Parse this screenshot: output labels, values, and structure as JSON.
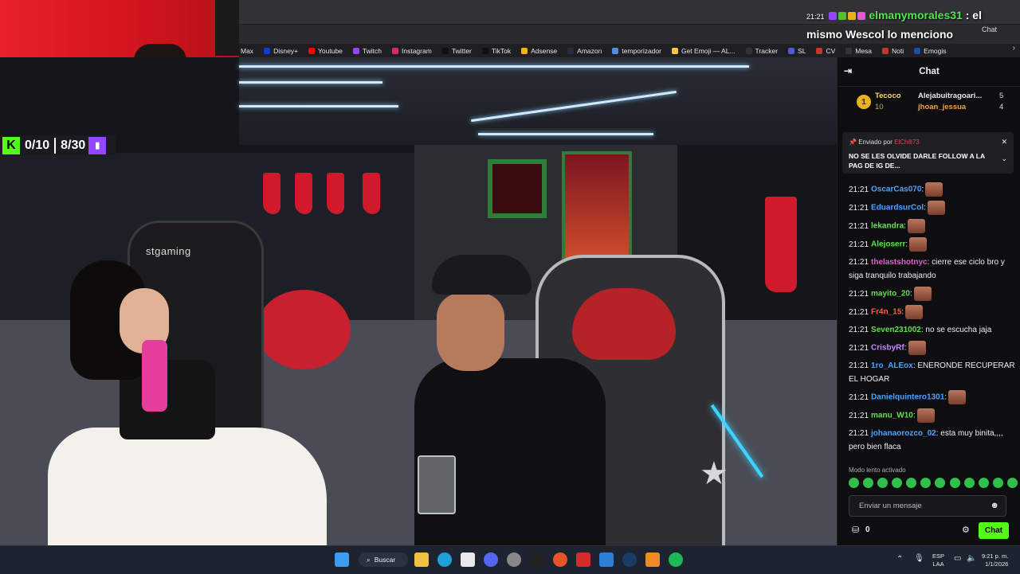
{
  "overlay": {
    "time": "21:21",
    "username": "elmanymorales31",
    "message_a": ": el",
    "message_b": "mismo Wescol lo menciono",
    "chat_label": "Chat"
  },
  "bookmarks": [
    {
      "label": "Max",
      "color": "#2a50d6"
    },
    {
      "label": "Disney+",
      "color": "#113ccf"
    },
    {
      "label": "Youtube",
      "color": "#ff0000"
    },
    {
      "label": "Twitch",
      "color": "#9146ff"
    },
    {
      "label": "Instagram",
      "color": "#d62976"
    },
    {
      "label": "Twitter",
      "color": "#111111"
    },
    {
      "label": "TikTok",
      "color": "#111111"
    },
    {
      "label": "Adsense",
      "color": "#f4b400"
    },
    {
      "label": "Amazon",
      "color": "#232f3e"
    },
    {
      "label": "temporizador",
      "color": "#4a90e2"
    },
    {
      "label": "Get Emoji — AL...",
      "color": "#f6c343"
    },
    {
      "label": "Tracker",
      "color": "#333333"
    },
    {
      "label": "SL",
      "color": "#4b5bd6"
    },
    {
      "label": "CV",
      "color": "#c0392b"
    },
    {
      "label": "Mesa",
      "color": "#333333"
    },
    {
      "label": "Noti",
      "color": "#c0392b"
    },
    {
      "label": "Emogis",
      "color": "#1d4ea8"
    }
  ],
  "counter": {
    "k": "K",
    "first": "0/10",
    "second": "8/30"
  },
  "video": {
    "chair_brand": "stgaming"
  },
  "chat": {
    "header": "Chat",
    "leaderboard": {
      "rank": "1",
      "first_name": "Tecoco",
      "first_value": "10",
      "second_name": "Alejabuitragoari...",
      "second_value": "5",
      "third_name": "jhoan_jessua",
      "third_value": "4"
    },
    "pinned": {
      "by_label": "Enviado por",
      "by_user": "ElChill73",
      "text": "NO SE LES OLVIDE DARLE FOLLOW A LA PAG DE IG DE..."
    },
    "messages": [
      {
        "time": "21:21",
        "user": "OscarCas070",
        "color": "#4aa3ff",
        "text": ":",
        "emote": true
      },
      {
        "time": "21:21",
        "user": "EduardsurCol",
        "color": "#4aa3ff",
        "text": ":",
        "emote": true
      },
      {
        "time": "21:21",
        "user": "lekandra",
        "color": "#5fe14f",
        "text": ":",
        "emote": true
      },
      {
        "time": "21:21",
        "user": "Alejoserr",
        "color": "#5fe14f",
        "text": ":",
        "emote": true
      },
      {
        "time": "21:21",
        "user": "thelastshotnyc",
        "color": "#e05bd4",
        "text": ": cierre ese ciclo bro y siga tranquilo trabajando",
        "emote": false
      },
      {
        "time": "21:21",
        "user": "mayito_20",
        "color": "#5fe14f",
        "text": ":",
        "emote": true
      },
      {
        "time": "21:21",
        "user": "Fr4n_15",
        "color": "#ff5a3c",
        "text": ":",
        "emote": true
      },
      {
        "time": "21:21",
        "user": "Seven231002",
        "color": "#5fe14f",
        "text": ": no se escucha jaja",
        "emote": false
      },
      {
        "time": "21:21",
        "user": "CrisbyRf",
        "color": "#c387ff",
        "text": ":",
        "emote": true
      },
      {
        "time": "21:21",
        "user": "1ro_ALEox",
        "color": "#4aa3ff",
        "text": ": ENERONDE RECUPERAR EL HOGAR",
        "emote": false
      },
      {
        "time": "21:21",
        "user": "Danielquintero1301",
        "color": "#4aa3ff",
        "text": ":",
        "emote": true
      },
      {
        "time": "21:21",
        "user": "manu_W10",
        "color": "#5fe14f",
        "text": ":",
        "emote": true
      },
      {
        "time": "21:21",
        "user": "johanaorozco_02",
        "color": "#4aa3ff",
        "text": ": esta muy binita,,,, pero bien flaca",
        "emote": false
      }
    ],
    "slow_mode": "Modo lento activado",
    "input_placeholder": "Enviar un mensaje",
    "points": "0",
    "send_label": "Chat"
  },
  "taskbar": {
    "search_label": "Buscar",
    "lang_top": "ESP",
    "lang_bottom": "LAA",
    "time": "9:21 p. m.",
    "date": "1/1/2026"
  }
}
